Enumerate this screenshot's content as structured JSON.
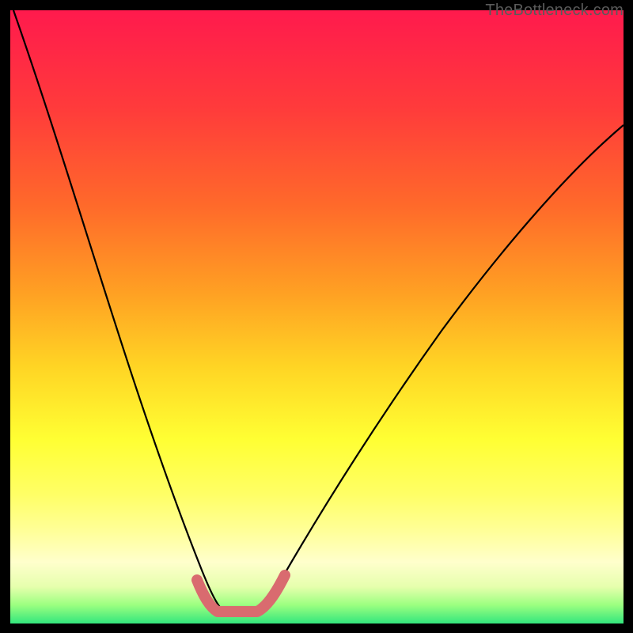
{
  "watermark": {
    "text": "TheBottleneck.com"
  },
  "chart_data": {
    "type": "line",
    "title": "",
    "xlabel": "",
    "ylabel": "",
    "xlim": [
      0,
      100
    ],
    "ylim": [
      0,
      100
    ],
    "series": [
      {
        "name": "bottleneck-curve",
        "x": [
          0,
          4,
          8,
          12,
          16,
          20,
          24,
          28,
          30,
          31,
          33,
          36,
          39,
          41,
          44,
          48,
          54,
          60,
          66,
          72,
          78,
          84,
          90,
          96,
          100
        ],
        "y": [
          100,
          85,
          71,
          58,
          46,
          35,
          25,
          15,
          9,
          6,
          3,
          1,
          1,
          1,
          3,
          7,
          14,
          22,
          31,
          39,
          47,
          55,
          62,
          69,
          73
        ]
      },
      {
        "name": "optimal-marker",
        "x": [
          30,
          31,
          33,
          36,
          39,
          41,
          43,
          45
        ],
        "y": [
          6,
          3,
          1.5,
          1,
          1,
          1.5,
          3,
          6
        ]
      }
    ],
    "colors": {
      "curve": "#000000",
      "optimal_marker": "#d96b6f",
      "background_gradient_top": "#ff1a4d",
      "background_gradient_bottom": "#33e67d"
    }
  }
}
